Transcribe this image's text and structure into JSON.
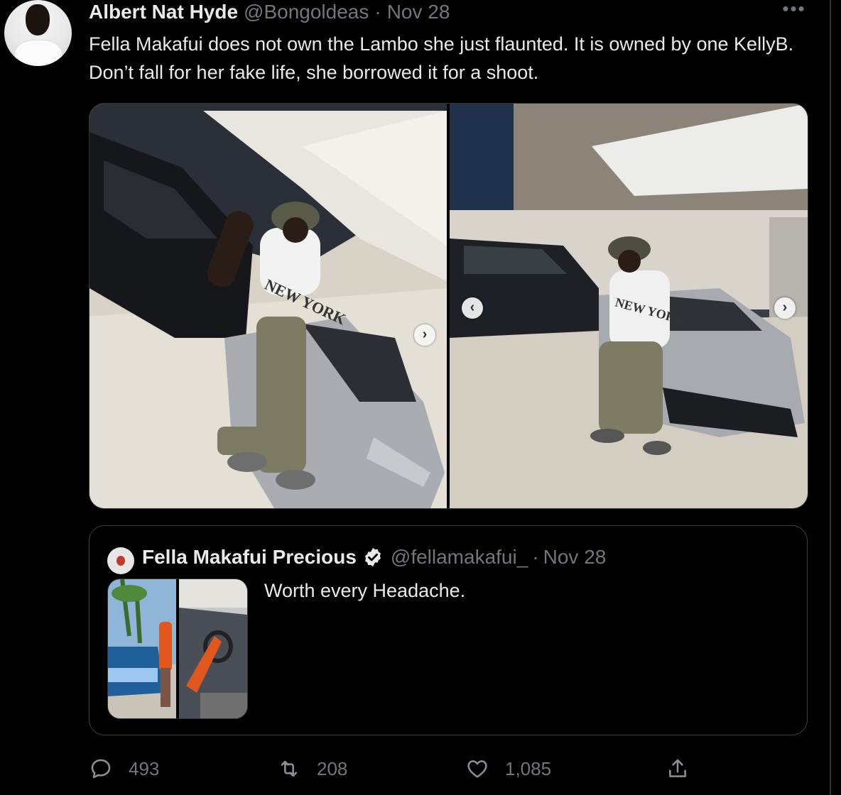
{
  "tweet": {
    "author_name": "Albert Nat Hyde",
    "handle": "@Bongoldeas",
    "separator": "·",
    "date": "Nov 28",
    "text": "Fella Makafui does not own the Lambo she just flaunted. It is owned by one KellyB. Don’t fall for her fake life, she borrowed it for a shoot.",
    "more_icon": "•••"
  },
  "media": {
    "left_photo": {
      "shirt_text": "NEW YORK",
      "next_icon": "›"
    },
    "right_photo": {
      "shirt_text": "NEW YORK",
      "prev_icon": "‹",
      "next_icon": "›"
    }
  },
  "quote": {
    "author_name": "Fella Makafui Precious",
    "handle": "@fellamakafui_",
    "separator": "·",
    "date": "Nov 28",
    "text": "Worth every Headache.",
    "verified": true
  },
  "actions": {
    "replies": "493",
    "retweets": "208",
    "likes": "1,085"
  },
  "colors": {
    "background": "#000000",
    "text_primary": "#e7e9ea",
    "text_secondary": "#71767b",
    "border": "#2f3336"
  },
  "icons": {
    "reply": "reply-icon",
    "retweet": "retweet-icon",
    "like": "heart-icon",
    "share": "share-icon",
    "more": "more-icon",
    "verified": "verified-badge-icon"
  }
}
